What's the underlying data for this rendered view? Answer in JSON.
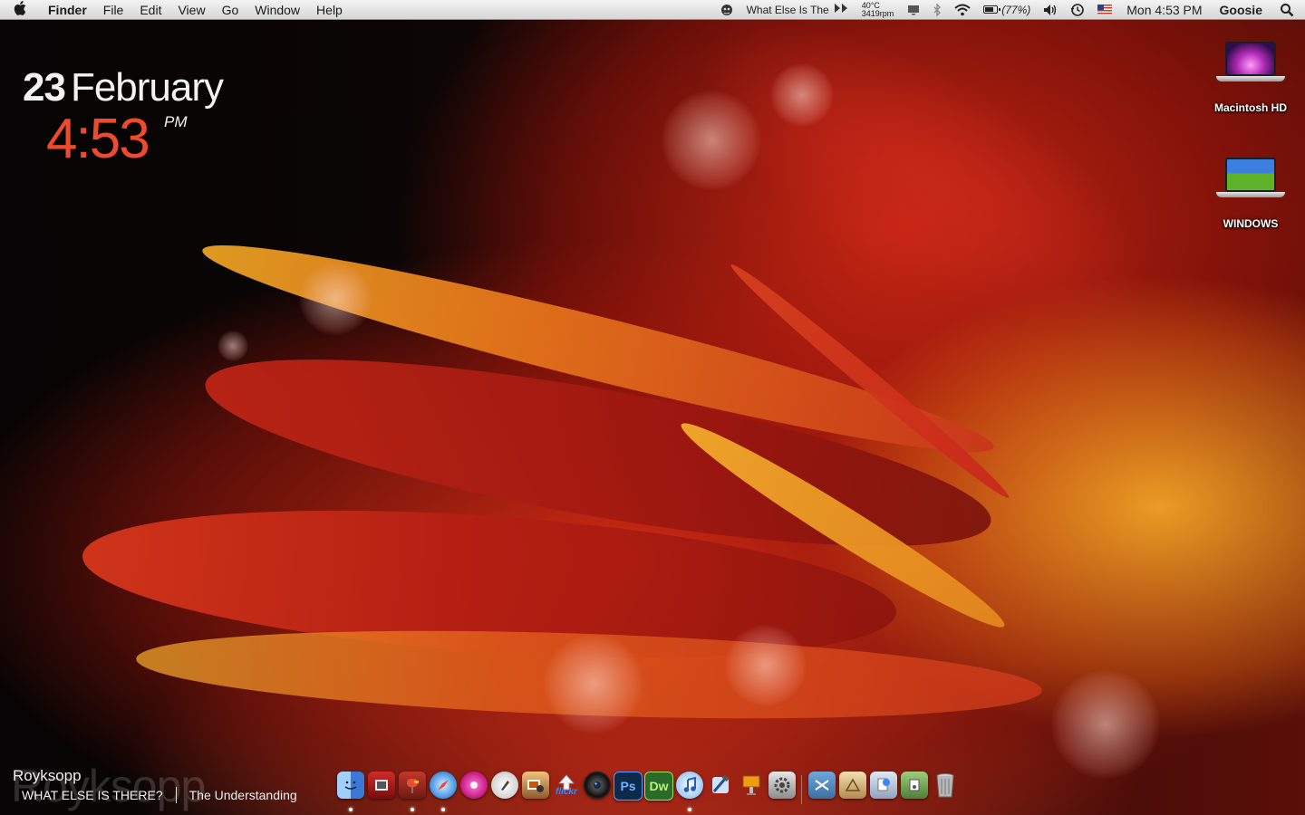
{
  "menubar": {
    "app_name": "Finder",
    "menus": [
      "File",
      "Edit",
      "View",
      "Go",
      "Window",
      "Help"
    ],
    "now_playing_status": "What Else Is The",
    "temperature": "40°C",
    "fan_speed": "3419rpm",
    "battery_percent": "(77%)",
    "battery_level": 0.77,
    "clock": "Mon 4:53 PM",
    "user": "Goosie"
  },
  "date_widget": {
    "day": "23",
    "month": "February",
    "time": "4:53",
    "ampm": "PM"
  },
  "desktop": {
    "icons": [
      {
        "label": "Macintosh HD",
        "icon": "hard-drive-icon"
      },
      {
        "label": "WINDOWS",
        "icon": "windows-drive-icon"
      }
    ]
  },
  "now_playing": {
    "artist": "Royksopp",
    "watermark": "Royksopp",
    "album": "WHAT ELSE IS THERE?",
    "track": "The Understanding"
  },
  "dock": {
    "flickr_label": "flickr",
    "ps_label": "Ps",
    "dw_label": "Dw",
    "colors": {
      "finder": "#4a90e2",
      "photoshop": "#0d2a4a",
      "dreamweaver": "#2a6b2a",
      "trash": "#9a9a9a"
    }
  }
}
